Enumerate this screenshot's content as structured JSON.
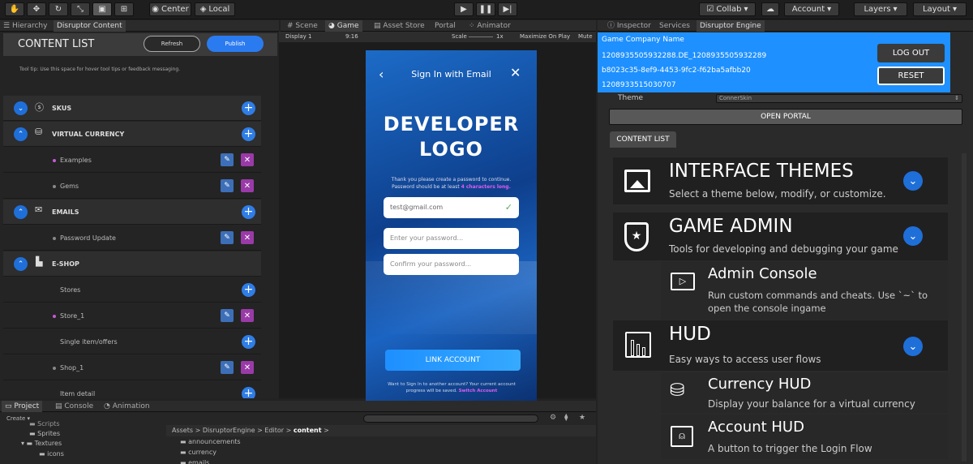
{
  "toolbar": {
    "pivot_label": "Center",
    "space_label": "Local",
    "collab_label": "Collab",
    "account_label": "Account",
    "layers_label": "Layers",
    "layout_label": "Layout"
  },
  "left_tabs": [
    {
      "label": "Hierarchy"
    },
    {
      "label": "Disruptor Content"
    }
  ],
  "center_tabs": [
    {
      "label": "Scene"
    },
    {
      "label": "Game"
    },
    {
      "label": "Asset Store"
    },
    {
      "label": "Portal"
    },
    {
      "label": "Animator"
    }
  ],
  "right_tabs": [
    {
      "label": "Inspector"
    },
    {
      "label": "Services"
    },
    {
      "label": "Disruptor Engine"
    }
  ],
  "content_list": {
    "title": "CONTENT LIST",
    "refresh_label": "Refresh",
    "publish_label": "Publish",
    "tooltip": "Tool tip: Use this space for hover tool tips or feedback messaging.",
    "rows": [
      {
        "label": "SKUS"
      },
      {
        "label": "VIRTUAL CURRENCY"
      },
      {
        "label": "Examples"
      },
      {
        "label": "Gems"
      },
      {
        "label": "EMAILS"
      },
      {
        "label": "Password Update"
      },
      {
        "label": "E-SHOP"
      },
      {
        "label": "Stores"
      },
      {
        "label": "Store_1"
      },
      {
        "label": "Single item/offers"
      },
      {
        "label": "Shop_1"
      },
      {
        "label": "Item detail"
      }
    ]
  },
  "game_view": {
    "display": "Display 1",
    "aspect": "9:16",
    "scale_label": "Scale",
    "scale_value": "1x",
    "maximize_label": "Maximize On Play",
    "mute_label": "Mute"
  },
  "phone": {
    "header": "Sign In with Email",
    "logo_line1": "DEVELOPER",
    "logo_line2": "LOGO",
    "instruction": "Thank you please create a password to continue. Password should be at least",
    "instruction_highlight": "4 characters long.",
    "email_value": "test@gmail.com",
    "password_placeholder": "Enter your password...",
    "confirm_placeholder": "Confirm your password...",
    "link_button": "LINK ACCOUNT",
    "footer": "Want to Sign In to another account? Your current account progress will be saved.",
    "footer_link": "Switch Account"
  },
  "bottom_tabs": [
    {
      "label": "Project"
    },
    {
      "label": "Console"
    },
    {
      "label": "Animation"
    }
  ],
  "project": {
    "create_label": "Create",
    "tree": [
      {
        "label": "Scripts"
      },
      {
        "label": "Sprites"
      },
      {
        "label": "Textures"
      },
      {
        "label": "icons"
      }
    ],
    "breadcrumb": [
      "Assets",
      "DisruptorEngine",
      "Editor",
      "content"
    ],
    "files": [
      {
        "label": "announcements"
      },
      {
        "label": "currency"
      },
      {
        "label": "emails"
      }
    ]
  },
  "engine": {
    "company_name": "Game Company Name",
    "id1": "1208935505932288.DE_1208935505932289",
    "id2": "b8023c35-8ef9-4453-9fc2-f62ba5afbb20",
    "id3": "1208933515030707",
    "logout_label": "LOG OUT",
    "reset_label": "RESET",
    "theme_label": "Theme",
    "theme_value": "ConnerSkin",
    "open_portal_label": "OPEN PORTAL",
    "content_list_tab": "CONTENT LIST",
    "sections": [
      {
        "title": "INTERFACE THEMES",
        "desc": "Select a theme below, modify, or customize."
      },
      {
        "title": "GAME ADMIN",
        "desc": "Tools for developing and debugging your game"
      },
      {
        "title": "HUD",
        "desc": "Easy ways to access user flows"
      }
    ],
    "admin_console": {
      "title": "Admin Console",
      "desc1": "Run custom commands and cheats. Use `~` to",
      "desc2": "open the console ingame"
    },
    "currency_hud": {
      "title": "Currency HUD",
      "desc": "Display your balance for a virtual currency"
    },
    "account_hud": {
      "title": "Account HUD",
      "desc": "A button to trigger the Login Flow"
    }
  },
  "colors": {
    "accent": "#1f6fd9",
    "highlight": "#1e90ff",
    "purple": "#9a3aa8",
    "pink": "#e05cf0"
  }
}
